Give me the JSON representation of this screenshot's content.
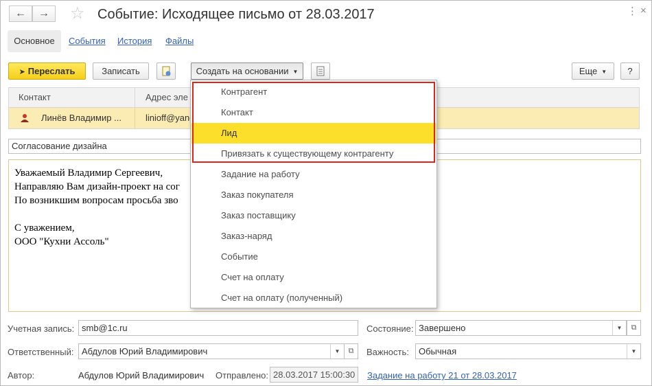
{
  "window": {
    "title": "Событие: Исходящее письмо от 28.03.2017"
  },
  "tabs": [
    {
      "label": "Основное"
    },
    {
      "label": "События"
    },
    {
      "label": "История"
    },
    {
      "label": "Файлы"
    }
  ],
  "toolbar": {
    "forward_label": "Переслать",
    "save_label": "Записать",
    "create_based_label": "Создать на основании",
    "more_label": "Еще",
    "help_label": "?"
  },
  "recipients_table": {
    "columns": [
      "Контакт",
      "Адрес эле"
    ],
    "rows": [
      {
        "contact": "Линёв Владимир ...",
        "address": "linioff@yand"
      }
    ]
  },
  "subject": {
    "value": "Согласование дизайна"
  },
  "body_lines": [
    "Уважаемый Владимир Сергеевич,",
    "Направляю Вам дизайн-проект на сог",
    "По возникшим вопросам просьба зво",
    "",
    "С уважением,",
    "ООО \"Кухни Ассоль\""
  ],
  "create_based_menu": {
    "items": [
      {
        "label": "Контрагент"
      },
      {
        "label": "Контакт"
      },
      {
        "label": "Лид"
      },
      {
        "label": "Привязать к существующему контрагенту"
      },
      {
        "label": "Задание на работу"
      },
      {
        "label": "Заказ покупателя"
      },
      {
        "label": "Заказ поставщику"
      },
      {
        "label": "Заказ-наряд"
      },
      {
        "label": "Событие"
      },
      {
        "label": "Счет на оплату"
      },
      {
        "label": "Счет на оплату (полученный)"
      }
    ],
    "selected_label": "Лид"
  },
  "fields": {
    "account_label": "Учетная запись:",
    "account_value": "smb@1c.ru",
    "status_label": "Состояние:",
    "status_value": "Завершено",
    "responsible_label": "Ответственный:",
    "responsible_value": "Абдулов Юрий Владимирович",
    "importance_label": "Важность:",
    "importance_value": "Обычная",
    "author_label": "Автор:",
    "author_value": "Абдулов Юрий Владимирович",
    "sent_label": "Отправлено:",
    "sent_value": "28.03.2017 15:00:30",
    "task_link": "Задание на работу 21 от 28.03.2017"
  },
  "colors": {
    "accent_yellow": "#f6cf1a",
    "selected_row": "#fbecb3",
    "highlight_box": "#e2231a",
    "link": "#3361b8"
  }
}
